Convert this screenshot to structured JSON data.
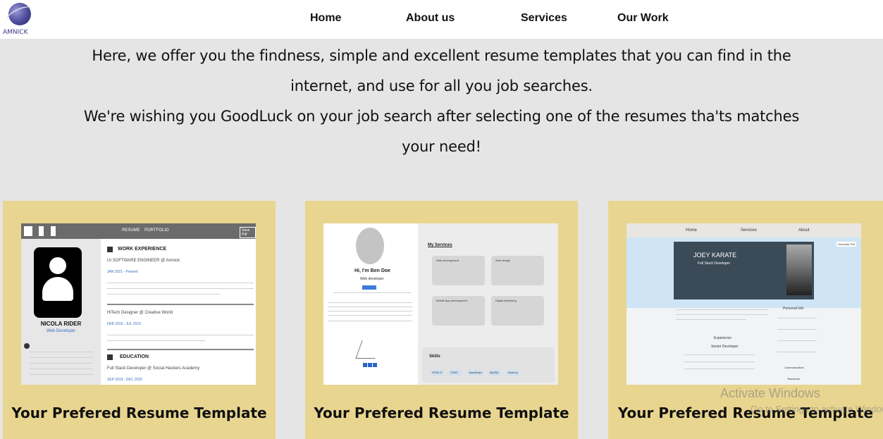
{
  "brand": {
    "logo_text": "AMNICK"
  },
  "nav": {
    "items": [
      {
        "label": "Home"
      },
      {
        "label": "About us"
      },
      {
        "label": "Services"
      },
      {
        "label": "Our Work"
      }
    ]
  },
  "intro": {
    "line1": "Here, we offer you the findness, simple and excellent resume templates that you can find in the",
    "line2": "internet, and use for all you job searches.",
    "line3": "We're wishing you GoodLuck on your job search after selecting one of the resumes tha'ts matches",
    "line4": "your need!"
  },
  "cards": [
    {
      "title": "Your Prefered Resume Template",
      "thumb": {
        "nav_resume": "RESUME",
        "nav_portfolio": "PORTFOLIO",
        "button": "Save Pdf",
        "name": "NICOLA RIDER",
        "role": "Web Developer",
        "section_work": "WORK EXPERIENCE",
        "job1": "UI SOFTWARE ENGINEER @ Amnick",
        "job1_date": "JAN 2021 - Present",
        "job2": "HiTech Designer @ Creative World",
        "job2_date": "FEB 2019 - JUL 2019",
        "section_edu": "EDUCATION",
        "edu1": "Full Stack Developer @ Social Hackers Academy",
        "edu1_date": "SEP 2019 - DEC 2020"
      }
    },
    {
      "title": "Your Prefered Resume Template",
      "thumb": {
        "name": "Hi, I'm Ben Doe",
        "role": "Web developer",
        "services_heading": "My Services",
        "service1": "Web development",
        "service2": "Web design",
        "service3": "Mobile App development",
        "service4": "Digital Marketing",
        "skills_heading": "Skills",
        "skills": [
          "HTML 5",
          "CSS3",
          "JavaScript",
          "MySQL",
          "Node.js"
        ]
      }
    },
    {
      "title": "Your Prefered Resume Template",
      "thumb": {
        "nav_home": "Home",
        "nav_services": "Services",
        "nav_about": "About",
        "button": "Generate Pdf",
        "name": "JOEY KARATE",
        "role": "Full Stack Developer",
        "experience": "Experience",
        "job_title": "Senior Developer",
        "personal_info": "Personal Info",
        "communication": "Communication",
        "teamwork": "Teamwork"
      }
    }
  ],
  "watermark": {
    "title": "Activate Windows",
    "subtitle": "Go to Settings to activate Windows."
  }
}
